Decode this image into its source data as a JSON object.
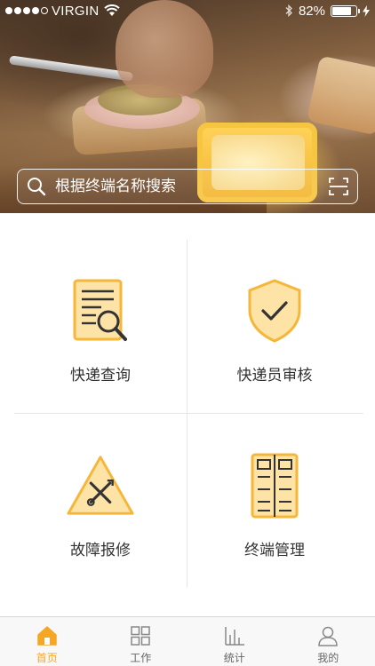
{
  "status_bar": {
    "carrier": "VIRGIN",
    "battery_percent": "82%",
    "battery_level": 0.82
  },
  "search": {
    "placeholder": "根据终端名称搜索"
  },
  "menu": {
    "items": [
      {
        "label": "快递查询",
        "icon": "document-magnifier-icon"
      },
      {
        "label": "快递员审核",
        "icon": "shield-check-icon"
      },
      {
        "label": "故障报修",
        "icon": "warning-tools-icon"
      },
      {
        "label": "终端管理",
        "icon": "locker-cabinet-icon"
      }
    ]
  },
  "tab_bar": {
    "tabs": [
      {
        "label": "首页",
        "icon": "home-icon",
        "active": true
      },
      {
        "label": "工作",
        "icon": "grid-icon",
        "active": false
      },
      {
        "label": "统计",
        "icon": "bar-chart-icon",
        "active": false
      },
      {
        "label": "我的",
        "icon": "user-icon",
        "active": false
      }
    ]
  },
  "colors": {
    "accent": "#f5a623",
    "icon_fill": "#fde3a6",
    "icon_stroke": "#f5b63a"
  }
}
